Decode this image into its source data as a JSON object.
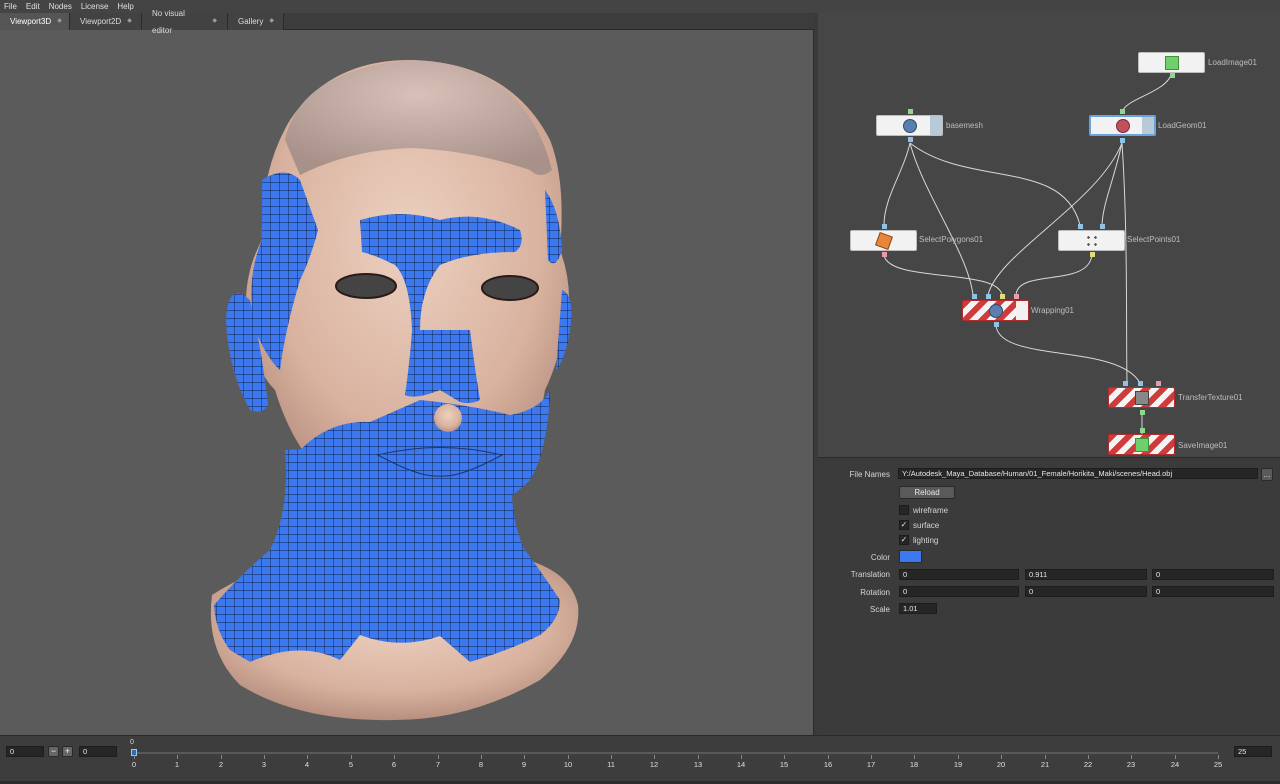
{
  "menu": [
    "File",
    "Edit",
    "Nodes",
    "License",
    "Help"
  ],
  "tabs": [
    {
      "label": "Viewport3D",
      "active": true
    },
    {
      "label": "Viewport2D",
      "active": false
    },
    {
      "label": "No visual editor",
      "active": false
    },
    {
      "label": "Gallery",
      "active": false
    }
  ],
  "nodes": {
    "loadimage": "LoadImage01",
    "basemesh": "basemesh",
    "loadgeom": "LoadGeom01",
    "selectpolygons": "SelectPolygons01",
    "selectpoints": "SelectPoints01",
    "wrapping": "Wrapping01",
    "transfertexture": "TransferTexture01",
    "saveimage": "SaveImage01"
  },
  "properties": {
    "file_names_label": "File Names",
    "file_path": "Y:/Autodesk_Maya_Database/Human/01_Female/Horikita_Maki/scenes/Head.obj",
    "browse_label": "...",
    "reload_label": "Reload",
    "wireframe": {
      "label": "wireframe",
      "checked": false
    },
    "surface": {
      "label": "surface",
      "checked": true
    },
    "lighting": {
      "label": "lighting",
      "checked": true
    },
    "color_label": "Color",
    "color": "#3c79f0",
    "translation_label": "Translation",
    "translation": [
      "0",
      "0.911",
      "0"
    ],
    "rotation_label": "Rotation",
    "rotation": [
      "0",
      "0",
      "0"
    ],
    "scale_label": "Scale",
    "scale": "1.01"
  },
  "timeline": {
    "start": "0",
    "current": "0",
    "end": "25",
    "playhead_label": "0",
    "minus": "−",
    "plus": "+",
    "ticks": [
      "0",
      "1",
      "2",
      "3",
      "4",
      "5",
      "6",
      "7",
      "8",
      "9",
      "10",
      "11",
      "12",
      "13",
      "14",
      "15",
      "16",
      "17",
      "18",
      "19",
      "20",
      "21",
      "22",
      "23",
      "24",
      "25"
    ]
  },
  "colors": {
    "wrap_blue": "#3c79f0",
    "skin": "#e2c0ad",
    "viewport_bg": "#5b5b5b"
  }
}
